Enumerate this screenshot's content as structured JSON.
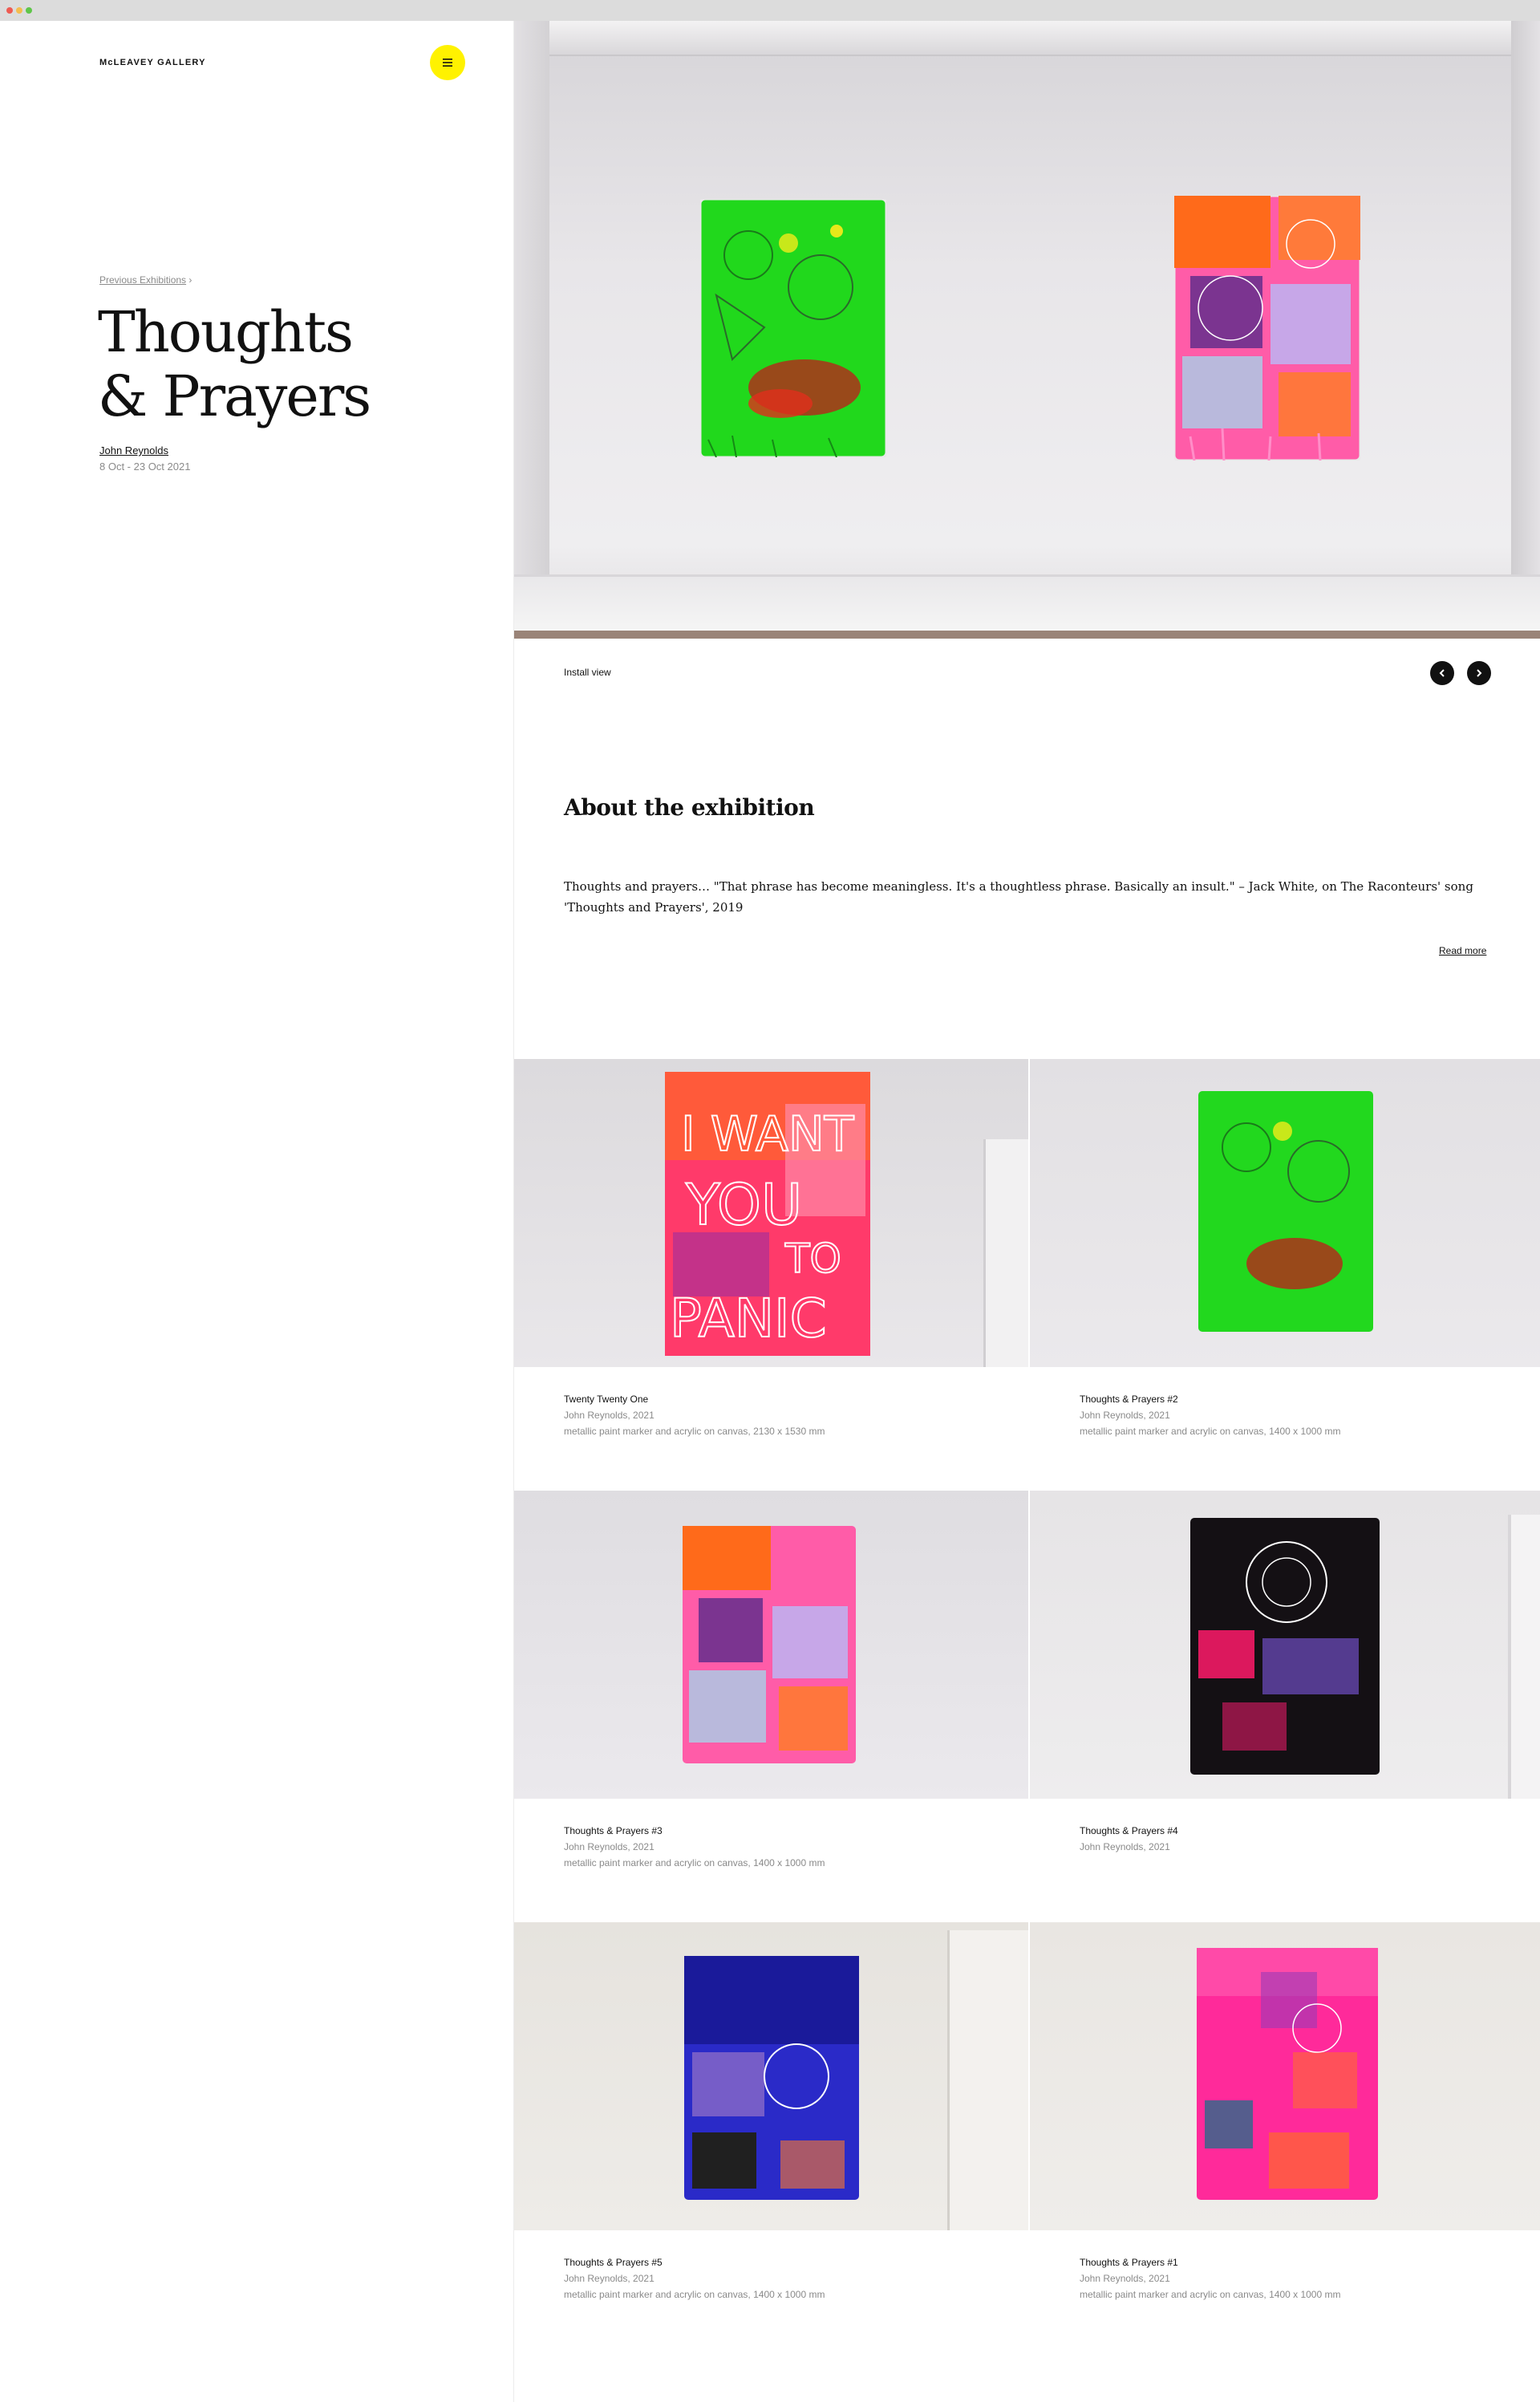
{
  "header": {
    "logo": "McLEAVEY GALLERY",
    "menu_icon": "hamburger-icon"
  },
  "breadcrumb": {
    "link": "Previous Exhibitions",
    "separator": "›"
  },
  "exhibition": {
    "title_line1": "Thoughts",
    "title_line2": "& Prayers",
    "artist": "John Reynolds",
    "dates": "8 Oct - 23 Oct 2021"
  },
  "hero": {
    "caption": "Install view",
    "prev_icon": "chevron-left-icon",
    "next_icon": "chevron-right-icon"
  },
  "about": {
    "heading": "About the exhibition",
    "text": "Thoughts and prayers… \"That phrase has become meaningless. It's a thoughtless phrase. Basically an insult.\" – Jack White, on The Raconteurs' song 'Thoughts and Prayers', 2019",
    "read_more": "Read more"
  },
  "works": [
    {
      "title": "Twenty Twenty One",
      "artist_year": "John Reynolds, 2021",
      "medium": "metallic paint marker and acrylic on canvas, 2130 x 1530 mm"
    },
    {
      "title": "Thoughts & Prayers #2",
      "artist_year": "John Reynolds, 2021",
      "medium": "metallic paint marker and acrylic on canvas, 1400 x 1000 mm"
    },
    {
      "title": "Thoughts & Prayers #3",
      "artist_year": "John Reynolds, 2021",
      "medium": "metallic paint marker and acrylic on canvas, 1400 x 1000 mm"
    },
    {
      "title": "Thoughts & Prayers #4",
      "artist_year": "John Reynolds, 2021",
      "medium": ""
    },
    {
      "title": "Thoughts & Prayers #5",
      "artist_year": "John Reynolds, 2021",
      "medium": "metallic paint marker and acrylic on canvas, 1400 x 1000 mm"
    },
    {
      "title": "Thoughts & Prayers #1",
      "artist_year": "John Reynolds, 2021",
      "medium": "metallic paint marker and acrylic on canvas, 1400 x 1000 mm"
    }
  ],
  "painting_text": {
    "line1": "I WANT",
    "line2": "YOU",
    "line3": "TO",
    "line4": "PANIC"
  },
  "colors": {
    "accent_yellow": "#fff200",
    "text_dark": "#111111",
    "text_muted": "#8a8a8a"
  }
}
